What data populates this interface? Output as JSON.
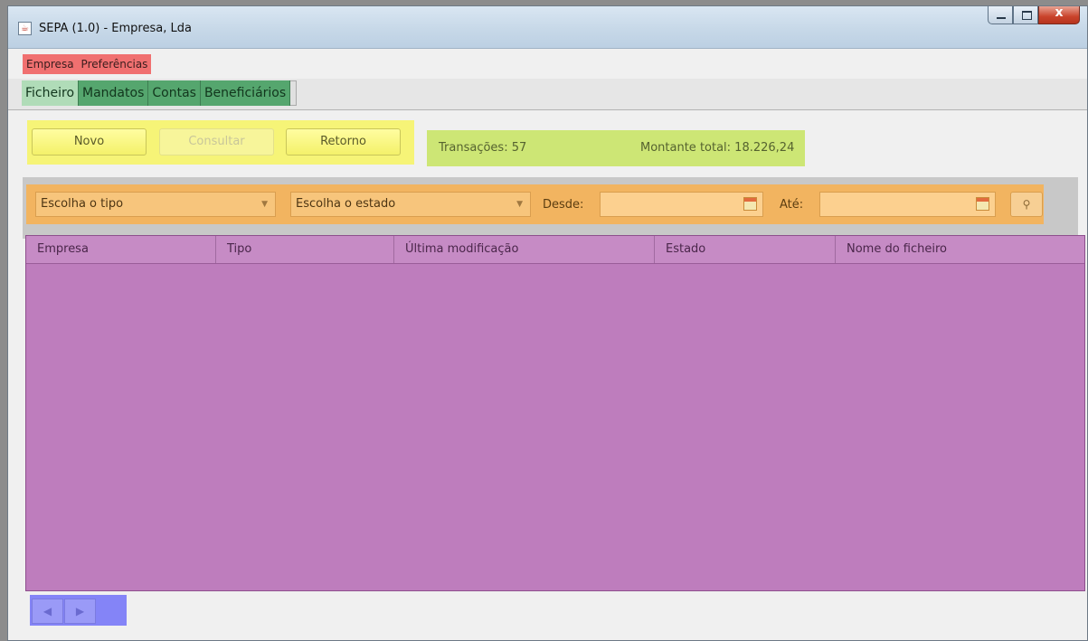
{
  "window": {
    "title": "SEPA (1.0) - Empresa, Lda"
  },
  "menu": {
    "items": [
      "Empresa",
      "Preferências"
    ]
  },
  "tabs": [
    "Ficheiro",
    "Mandatos",
    "Contas",
    "Beneficiários"
  ],
  "actions": {
    "novo": "Novo",
    "consultar": "Consultar",
    "retorno": "Retorno"
  },
  "summary": {
    "transacoes": "Transações: 57",
    "montante": "Montante total: 18.226,24"
  },
  "filters": {
    "tipo": "Escolha o tipo",
    "estado": "Escolha o estado",
    "desde_label": "Desde:",
    "ate_label": "Até:",
    "desde_value": "",
    "ate_value": ""
  },
  "table": {
    "columns": [
      "Empresa",
      "Tipo",
      "Última modificação",
      "Estado",
      "Nome do ficheiro"
    ],
    "rows": []
  },
  "pager": {
    "prev_icon": "previous-arrow",
    "next_icon": "next-arrow"
  },
  "colors": {
    "menu": "#f07070",
    "tabs": "#55a66e",
    "buttons": "#f6f477",
    "summary": "#cde675",
    "filters": "#f2b460",
    "table": "#be7dbd",
    "pager": "#8484f7"
  }
}
